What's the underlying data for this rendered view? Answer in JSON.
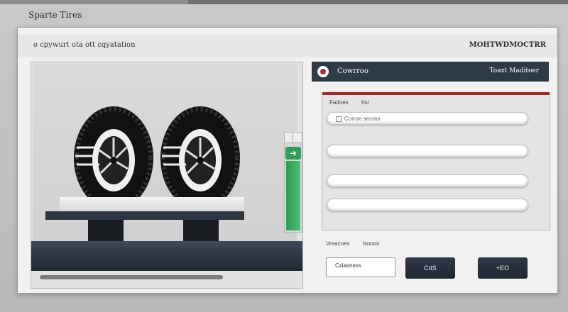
{
  "app": {
    "title": "Sparte Tires"
  },
  "window": {
    "subtitle": "o cpywurt ota ott cqyatation",
    "right_label": "MOHTWDMOCTRR"
  },
  "preview": {
    "slider_knob_icon": "arrow-right-icon",
    "slider_level": 0.7
  },
  "panel": {
    "logo_icon": "brand-logo-icon",
    "title": "Cowrroo",
    "right_text": "Toaxt  Maditoer",
    "tabs": [
      "Fadoes",
      "Itsr"
    ],
    "fields": [
      {
        "placeholder": "Corroe secran"
      },
      {
        "placeholder": ""
      },
      {
        "placeholder": ""
      },
      {
        "placeholder": ""
      }
    ],
    "footer_labels": [
      "Vreazoes",
      "Isnoos"
    ],
    "input_button": "Cxlasnexs",
    "cancel_button": "CdS",
    "ok_button": "+EO"
  },
  "colors": {
    "accent": "#a5232a",
    "header": "#2f3a47",
    "slider": "#2e9c55"
  }
}
